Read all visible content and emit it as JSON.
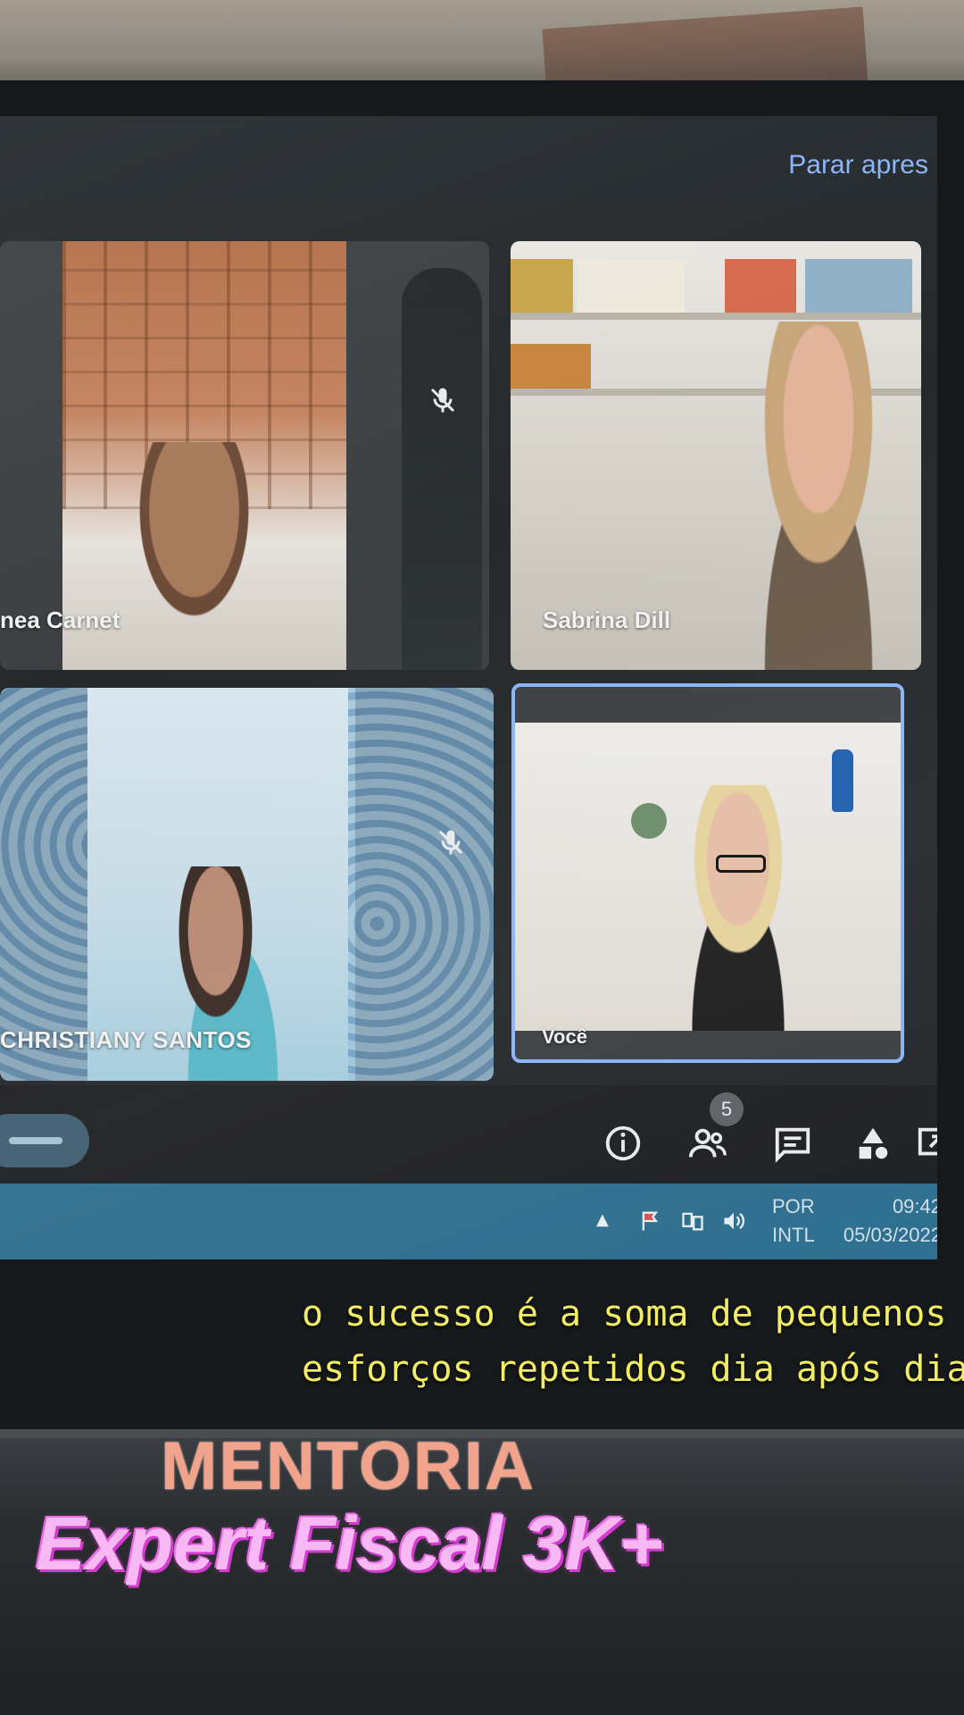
{
  "meet": {
    "stop_presenting_label": "Parar apres",
    "participants": [
      {
        "name": "nea Carnet",
        "muted": true
      },
      {
        "name": "Sabrina Dill",
        "muted": false
      },
      {
        "name": "CHRISTIANY SANTOS",
        "muted": true
      },
      {
        "name": "Você",
        "muted": false,
        "active": true
      }
    ],
    "controls": {
      "people_count": "5",
      "icons": [
        "info-icon",
        "people-icon",
        "chat-icon",
        "activities-icon",
        "more-icon"
      ]
    },
    "accent_color": "#8ab4f8"
  },
  "taskbar": {
    "lang_line1": "POR",
    "lang_line2": "INTL",
    "time": "09:42",
    "date": "05/03/2022"
  },
  "subtitles": {
    "line1": "o sucesso é a soma de pequenos",
    "line2": "esforços repetidos dia após dia."
  },
  "overlay": {
    "line1": "MENTORIA",
    "line2": "Expert Fiscal 3K+"
  }
}
